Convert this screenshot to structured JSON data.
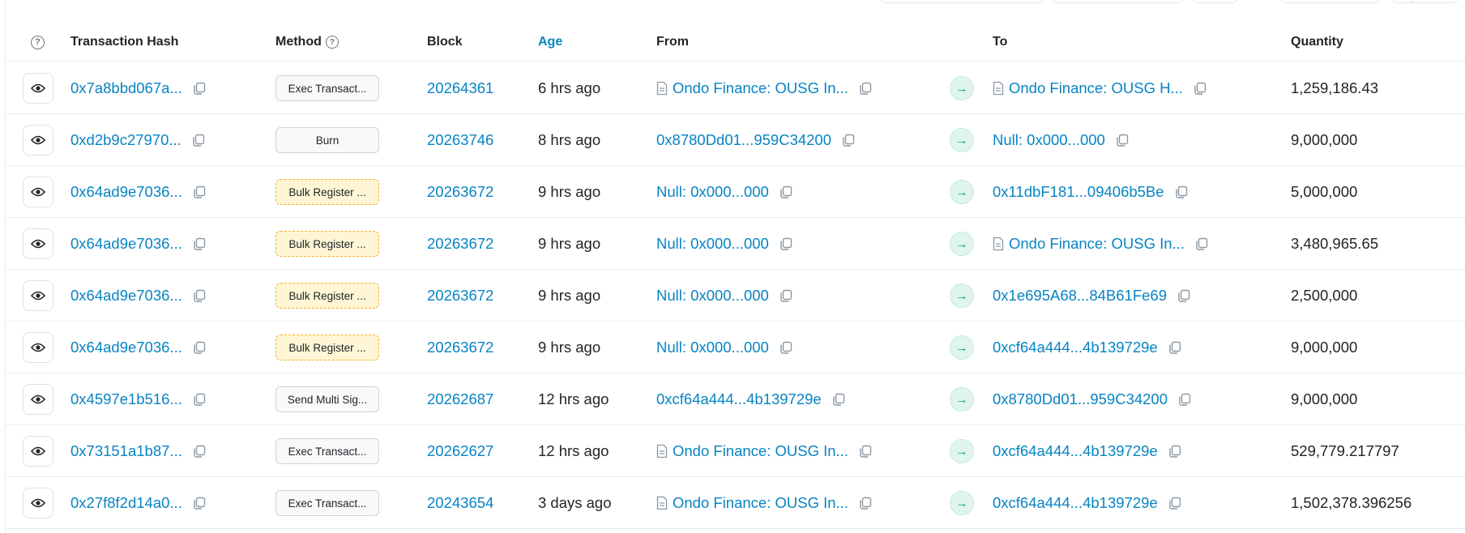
{
  "columns": {
    "tx_hash": "Transaction Hash",
    "method": "Method",
    "block": "Block",
    "age": "Age",
    "from": "From",
    "to": "To",
    "quantity": "Quantity"
  },
  "icons": {
    "help": "?",
    "arrow": "→"
  },
  "colors": {
    "link": "#0784c3",
    "arrow_green": "#00a186",
    "warn_bg": "#fff6d6"
  },
  "rows": [
    {
      "hash": "0x7a8bbd067a...",
      "method": "Exec Transact...",
      "method_style": "default",
      "block": "20264361",
      "age": "6 hrs ago",
      "from": "Ondo Finance: OUSG In...",
      "from_contract": true,
      "to": "Ondo Finance: OUSG H...",
      "to_contract": true,
      "quantity": "1,259,186.43"
    },
    {
      "hash": "0xd2b9c27970...",
      "method": "Burn",
      "method_style": "default",
      "block": "20263746",
      "age": "8 hrs ago",
      "from": "0x8780Dd01...959C34200",
      "from_contract": false,
      "to": "Null: 0x000...000",
      "to_contract": false,
      "quantity": "9,000,000"
    },
    {
      "hash": "0x64ad9e7036...",
      "method": "Bulk Register ...",
      "method_style": "warn",
      "block": "20263672",
      "age": "9 hrs ago",
      "from": "Null: 0x000...000",
      "from_contract": false,
      "to": "0x11dbF181...09406b5Be",
      "to_contract": false,
      "quantity": "5,000,000"
    },
    {
      "hash": "0x64ad9e7036...",
      "method": "Bulk Register ...",
      "method_style": "warn",
      "block": "20263672",
      "age": "9 hrs ago",
      "from": "Null: 0x000...000",
      "from_contract": false,
      "to": "Ondo Finance: OUSG In...",
      "to_contract": true,
      "quantity": "3,480,965.65"
    },
    {
      "hash": "0x64ad9e7036...",
      "method": "Bulk Register ...",
      "method_style": "warn",
      "block": "20263672",
      "age": "9 hrs ago",
      "from": "Null: 0x000...000",
      "from_contract": false,
      "to": "0x1e695A68...84B61Fe69",
      "to_contract": false,
      "quantity": "2,500,000"
    },
    {
      "hash": "0x64ad9e7036...",
      "method": "Bulk Register ...",
      "method_style": "warn",
      "block": "20263672",
      "age": "9 hrs ago",
      "from": "Null: 0x000...000",
      "from_contract": false,
      "to": "0xcf64a444...4b139729e",
      "to_contract": false,
      "quantity": "9,000,000"
    },
    {
      "hash": "0x4597e1b516...",
      "method": "Send Multi Sig...",
      "method_style": "default",
      "block": "20262687",
      "age": "12 hrs ago",
      "from": "0xcf64a444...4b139729e",
      "from_contract": false,
      "to": "0x8780Dd01...959C34200",
      "to_contract": false,
      "quantity": "9,000,000"
    },
    {
      "hash": "0x73151a1b87...",
      "method": "Exec Transact...",
      "method_style": "default",
      "block": "20262627",
      "age": "12 hrs ago",
      "from": "Ondo Finance: OUSG In...",
      "from_contract": true,
      "to": "0xcf64a444...4b139729e",
      "to_contract": false,
      "quantity": "529,779.217797"
    },
    {
      "hash": "0x27f8f2d14a0...",
      "method": "Exec Transact...",
      "method_style": "default",
      "block": "20243654",
      "age": "3 days ago",
      "from": "Ondo Finance: OUSG In...",
      "from_contract": true,
      "to": "0xcf64a444...4b139729e",
      "to_contract": false,
      "quantity": "1,502,378.396256"
    }
  ]
}
